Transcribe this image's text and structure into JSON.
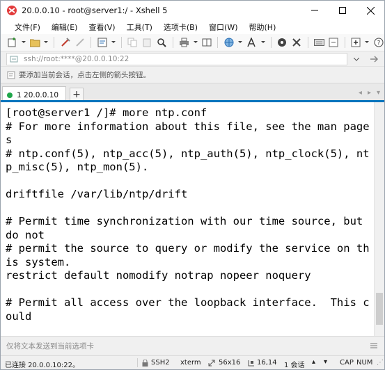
{
  "window": {
    "title": "20.0.0.10 - root@server1:/ - Xshell 5"
  },
  "menu": {
    "items": [
      "文件(F)",
      "编辑(E)",
      "查看(V)",
      "工具(T)",
      "选项卡(B)",
      "窗口(W)",
      "帮助(H)"
    ]
  },
  "address": {
    "value": "ssh://root:****@20.0.0.10:22"
  },
  "hint": {
    "text": "要添加当前会话，点击左侧的箭头按钮。"
  },
  "tabs": {
    "active_label": "1 20.0.0.10",
    "add_label": "+",
    "status_color": "#1fa64a",
    "accent_color": "#0073bd"
  },
  "terminal": {
    "lines": [
      "[root@server1 /]# more ntp.conf",
      "# For more information about this file, see the man page",
      "s",
      "# ntp.conf(5), ntp_acc(5), ntp_auth(5), ntp_clock(5), nt",
      "p_misc(5), ntp_mon(5).",
      "",
      "driftfile /var/lib/ntp/drift",
      "",
      "# Permit time synchronization with our time source, but",
      "do not",
      "# permit the source to query or modify the service on th",
      "is system.",
      "restrict default nomodify notrap nopeer noquery",
      "",
      "# Permit all access over the loopback interface.  This c",
      "ould"
    ]
  },
  "compose": {
    "placeholder": "仅将文本发送到当前选项卡"
  },
  "status": {
    "connection": "已连接 20.0.0.10:22。",
    "protocol": "SSH2",
    "terminal_type": "xterm",
    "size": "56x16",
    "cursor": "16,14",
    "sessions": "1 会话",
    "cap": "CAP",
    "num": "NUM"
  }
}
